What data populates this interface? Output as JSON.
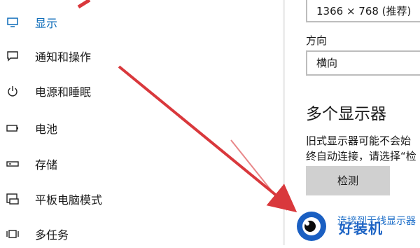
{
  "sidebar": {
    "items": [
      {
        "label": "显示",
        "icon": "monitor-icon",
        "active": true
      },
      {
        "label": "通知和操作",
        "icon": "notification-icon"
      },
      {
        "label": "电源和睡眠",
        "icon": "power-icon"
      },
      {
        "label": "电池",
        "icon": "battery-icon"
      },
      {
        "label": "存储",
        "icon": "storage-icon"
      },
      {
        "label": "平板电脑模式",
        "icon": "tablet-mode-icon"
      },
      {
        "label": "多任务",
        "icon": "multitasking-icon"
      }
    ]
  },
  "display": {
    "resolution_value": "1366 × 768 (推荐)",
    "orientation_label": "方向",
    "orientation_value": "横向",
    "multi_display_heading": "多个显示器",
    "multi_display_desc": "旧式显示器可能不会始终自动连接，请选择“检测”尝试连接它们。",
    "detect_button": "检测",
    "link_text": "连接到无线显示器"
  },
  "watermark": {
    "text": "好装机",
    "icon": "eye-logo-icon"
  },
  "colors": {
    "accent": "#0a6ab8",
    "annotation_arrow": "#d9383c",
    "watermark": "#1c63c4"
  }
}
